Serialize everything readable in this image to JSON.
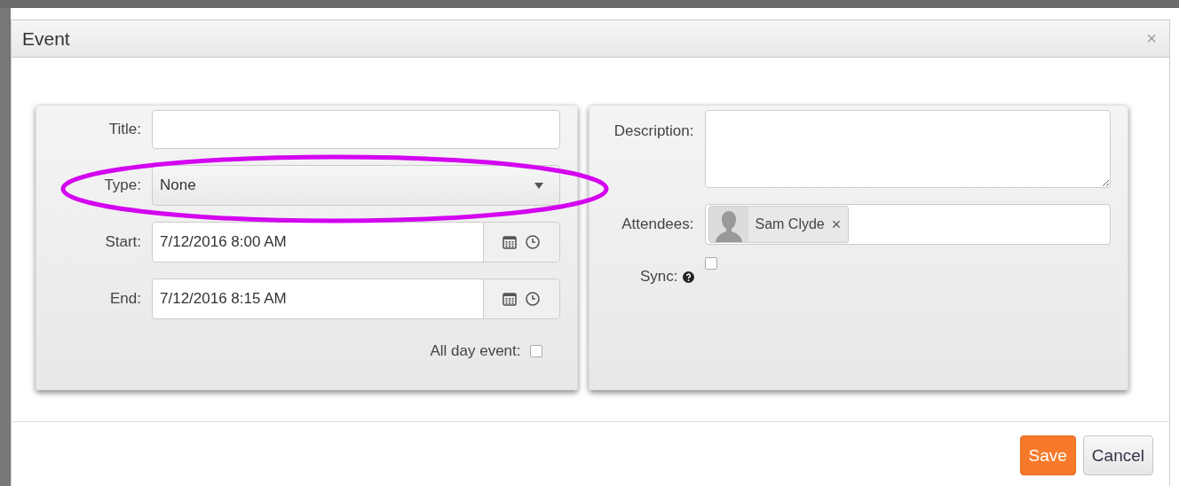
{
  "dialog": {
    "title": "Event",
    "close": "×"
  },
  "form_left": [
    {
      "kind": "text",
      "label": "Title:"
    },
    {
      "kind": "select",
      "label": "Type:",
      "value": "None"
    },
    {
      "kind": "datetime",
      "label": "Start:",
      "value": "7/12/2016 8:00 AM"
    },
    {
      "kind": "datetime",
      "label": "End:",
      "value": "7/12/2016 8:15 AM"
    },
    {
      "kind": "checkbox",
      "label": "All day event:",
      "checked": false
    }
  ],
  "form_right": [
    {
      "kind": "textarea",
      "label": "Description:"
    },
    {
      "kind": "tags",
      "label": "Attendees:",
      "tags": [
        {
          "name": "Sam Clyde",
          "remove": "×"
        }
      ]
    },
    {
      "kind": "checkbox",
      "label": "Sync:",
      "help": true,
      "checked": false
    }
  ],
  "buttons": [
    {
      "kind": "primary",
      "label": "Save"
    },
    {
      "kind": "default",
      "label": "Cancel"
    }
  ],
  "highlight": {
    "kind": "ellipse"
  }
}
